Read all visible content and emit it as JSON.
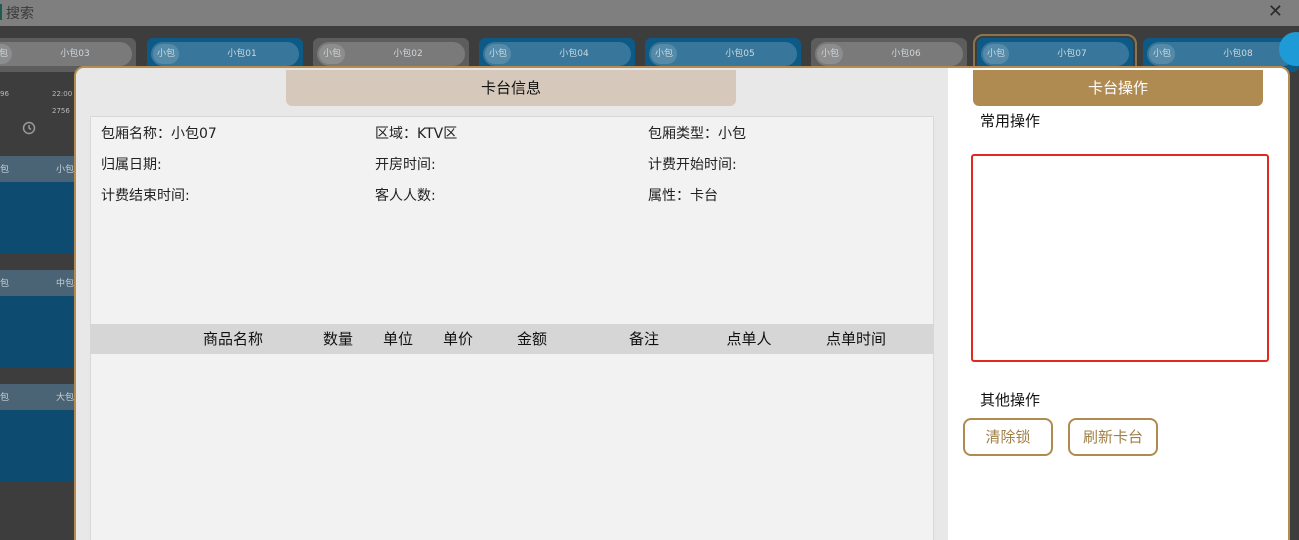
{
  "search": {
    "placeholder": "搜索",
    "close_glyph": "✕"
  },
  "rooms": [
    {
      "badge": "小包",
      "name": "小包03",
      "state": "gray"
    },
    {
      "badge": "小包",
      "name": "小包01",
      "state": "blue"
    },
    {
      "badge": "小包",
      "name": "小包02",
      "state": "gray"
    },
    {
      "badge": "小包",
      "name": "小包04",
      "state": "blue"
    },
    {
      "badge": "小包",
      "name": "小包05",
      "state": "blue"
    },
    {
      "badge": "小包",
      "name": "小包06",
      "state": "gray"
    },
    {
      "badge": "小包",
      "name": "小包07",
      "state": "blue"
    },
    {
      "badge": "小包",
      "name": "小包08",
      "state": "blue"
    }
  ],
  "left_tiles": [
    {
      "badge": "包",
      "name": "小包"
    },
    {
      "badge": "包",
      "name": "中包"
    },
    {
      "badge": "包",
      "name": "大包"
    }
  ],
  "bg_misc": {
    "time": "22:00",
    "num": "2756",
    "num2": "96"
  },
  "modal": {
    "left_tab": "卡台信息",
    "right_tab": "卡台操作",
    "info": {
      "room_name": "包厢名称：小包07",
      "area": "区域：KTV区",
      "room_type": "包厢类型：小包",
      "belong_date": "归属日期:",
      "open_time": "开房时间:",
      "bill_start": "计费开始时间:",
      "bill_end": "计费结束时间:",
      "guests": "客人人数:",
      "attribute": "属性：卡台"
    },
    "table_headers": [
      "商品名称",
      "数量",
      "单位",
      "单价",
      "金额",
      "备注",
      "点单人",
      "点单时间"
    ],
    "common_ops_title": "常用操作",
    "other_ops_title": "其他操作",
    "buttons": {
      "clear_lock": "清除锁",
      "refresh": "刷新卡台"
    },
    "colors": {
      "accent": "#b08b51",
      "highlight_border": "#e02a20"
    }
  }
}
